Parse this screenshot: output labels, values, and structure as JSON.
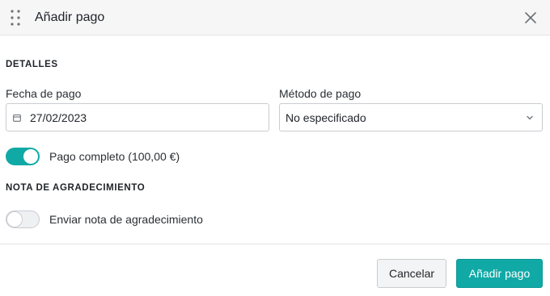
{
  "header": {
    "title": "Añadir pago",
    "drag_icon": "drag-handle-icon",
    "close_icon": "close-icon"
  },
  "details": {
    "section_title": "DETALLES",
    "date_label": "Fecha de pago",
    "date_value": "27/02/2023",
    "method_label": "Método de pago",
    "method_value": "No especificado",
    "full_payment_label": "Pago completo (100,00 €)",
    "full_payment_on": true
  },
  "thanks": {
    "section_title": "NOTA DE AGRADECIMIENTO",
    "send_label": "Enviar nota de agradecimiento",
    "send_on": false
  },
  "footer": {
    "cancel_label": "Cancelar",
    "submit_label": "Añadir pago"
  },
  "colors": {
    "accent": "#10a9a6",
    "header_bg": "#f6f6f7",
    "border": "#c9ccd1"
  }
}
